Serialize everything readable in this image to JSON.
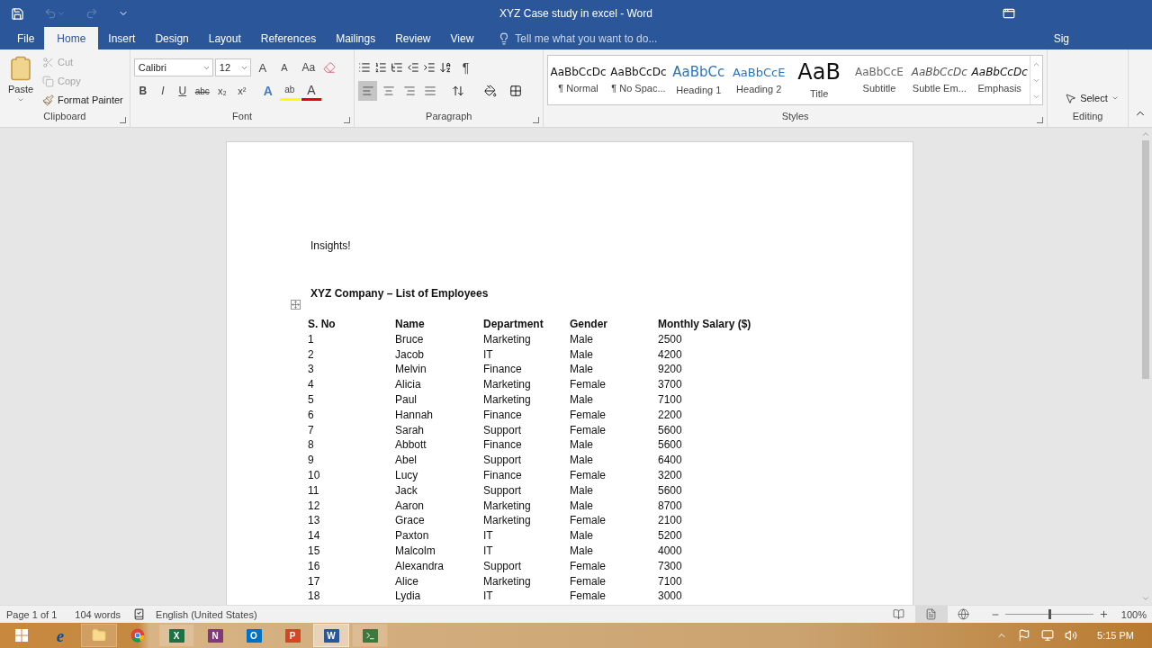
{
  "window": {
    "title": "XYZ Case study in excel - Word"
  },
  "tabs": [
    {
      "label": "File",
      "selected": false
    },
    {
      "label": "Home",
      "selected": true
    },
    {
      "label": "Insert",
      "selected": false
    },
    {
      "label": "Design",
      "selected": false
    },
    {
      "label": "Layout",
      "selected": false
    },
    {
      "label": "References",
      "selected": false
    },
    {
      "label": "Mailings",
      "selected": false
    },
    {
      "label": "Review",
      "selected": false
    },
    {
      "label": "View",
      "selected": false
    }
  ],
  "tell_me": {
    "placeholder": "Tell me what you want to do..."
  },
  "account": {
    "label": "Sig"
  },
  "clipboard": {
    "paste": "Paste",
    "items": [
      {
        "kind": "cut",
        "label": "Cut",
        "disabled": true
      },
      {
        "kind": "copy",
        "label": "Copy",
        "disabled": true
      },
      {
        "kind": "painter",
        "label": "Format Painter",
        "disabled": false
      }
    ],
    "label": "Clipboard"
  },
  "font": {
    "name": "Calibri",
    "size": "12",
    "grow": "A",
    "shrink": "A",
    "case": "Aa",
    "format_buttons": [
      {
        "label": "B",
        "kind": "bold",
        "selected": false
      },
      {
        "label": "I",
        "kind": "italic",
        "selected": false
      },
      {
        "label": "U",
        "kind": "underline",
        "selected": false
      },
      {
        "label": "abc",
        "kind": "strike",
        "selected": false
      },
      {
        "label": "x₂",
        "kind": "sub",
        "selected": false
      },
      {
        "label": "x²",
        "kind": "sup",
        "selected": false
      }
    ],
    "effects": "A",
    "highlight": "ab",
    "color_button": "A",
    "label": "Font"
  },
  "paragraph": {
    "pilcrow": "¶",
    "align": [
      {
        "kind": "left",
        "selected": true
      },
      {
        "kind": "center",
        "selected": false
      },
      {
        "kind": "right",
        "selected": false
      },
      {
        "kind": "justify",
        "selected": false
      }
    ],
    "label": "Paragraph"
  },
  "styles": {
    "items": [
      {
        "preview": "AaBbCcDc",
        "name": "¶ Normal",
        "kind": "normal"
      },
      {
        "preview": "AaBbCcDc",
        "name": "¶ No Spac...",
        "kind": "normal"
      },
      {
        "preview": "AaBbCc",
        "name": "Heading 1",
        "kind": "heading1"
      },
      {
        "preview": "AaBbCcE",
        "name": "Heading 2",
        "kind": "heading2"
      },
      {
        "preview": "AaB",
        "name": "Title",
        "kind": "title"
      },
      {
        "preview": "AaBbCcE",
        "name": "Subtitle",
        "kind": "subtitle"
      },
      {
        "preview": "AaBbCcDc",
        "name": "Subtle Em...",
        "kind": "subtle"
      },
      {
        "preview": "AaBbCcDc",
        "name": "Emphasis",
        "kind": "emphasis"
      }
    ],
    "label": "Styles"
  },
  "editing": {
    "select": "Select",
    "label": "Editing"
  },
  "document": {
    "intro": "Insights!",
    "heading": "XYZ Company – List of Employees",
    "columns": [
      "S. No",
      "Name",
      "Department",
      "Gender",
      "Monthly Salary ($)"
    ],
    "rows": [
      [
        "1",
        "Bruce",
        "Marketing",
        "Male",
        "2500"
      ],
      [
        "2",
        "Jacob",
        "IT",
        "Male",
        "4200"
      ],
      [
        "3",
        "Melvin",
        "Finance",
        "Male",
        "9200"
      ],
      [
        "4",
        "Alicia",
        "Marketing",
        "Female",
        "3700"
      ],
      [
        "5",
        "Paul",
        "Marketing",
        "Male",
        "7100"
      ],
      [
        "6",
        "Hannah",
        "Finance",
        "Female",
        "2200"
      ],
      [
        "7",
        "Sarah",
        "Support",
        "Female",
        "5600"
      ],
      [
        "8",
        "Abbott",
        "Finance",
        "Male",
        "5600"
      ],
      [
        "9",
        "Abel",
        "Support",
        "Male",
        "6400"
      ],
      [
        "10",
        "Lucy",
        "Finance",
        "Female",
        "3200"
      ],
      [
        "11",
        "Jack",
        "Support",
        "Male",
        "5600"
      ],
      [
        "12",
        "Aaron",
        "Marketing",
        "Male",
        "8700"
      ],
      [
        "13",
        "Grace",
        "Marketing",
        "Female",
        "2100"
      ],
      [
        "14",
        "Paxton",
        "IT",
        "Male",
        "5200"
      ],
      [
        "15",
        "Malcolm",
        "IT",
        "Male",
        "4000"
      ],
      [
        "16",
        "Alexandra",
        "Support",
        "Female",
        "7300"
      ],
      [
        "17",
        "Alice",
        "Marketing",
        "Female",
        "7100"
      ],
      [
        "18",
        "Lydia",
        "IT",
        "Female",
        "3000"
      ]
    ]
  },
  "status_bar": {
    "page": "Page 1 of 1",
    "words": "104 words",
    "language": "English (United States)",
    "views": [
      {
        "kind": "read",
        "selected": false
      },
      {
        "kind": "print",
        "selected": true
      },
      {
        "kind": "web",
        "selected": false
      }
    ],
    "zoom": {
      "level": 0.5,
      "reading": "100%"
    }
  },
  "taskbar": {
    "apps": [
      {
        "kind": "ie",
        "glyph": "e",
        "running": false,
        "selected": false
      },
      {
        "kind": "explorer",
        "running": true,
        "selected": false
      },
      {
        "kind": "chrome",
        "running": false,
        "selected": false
      },
      {
        "kind": "excel",
        "glyph": "X",
        "running": true,
        "selected": false
      },
      {
        "kind": "onenote",
        "glyph": "N",
        "running": false,
        "selected": false
      },
      {
        "kind": "outlook",
        "glyph": "O",
        "running": false,
        "selected": false
      },
      {
        "kind": "powerpoint",
        "glyph": "P",
        "running": false,
        "selected": false
      },
      {
        "kind": "word",
        "glyph": "W",
        "running": true,
        "selected": true
      },
      {
        "kind": "terminal",
        "running": true,
        "selected": false
      }
    ],
    "clock": "5:15 PM"
  }
}
